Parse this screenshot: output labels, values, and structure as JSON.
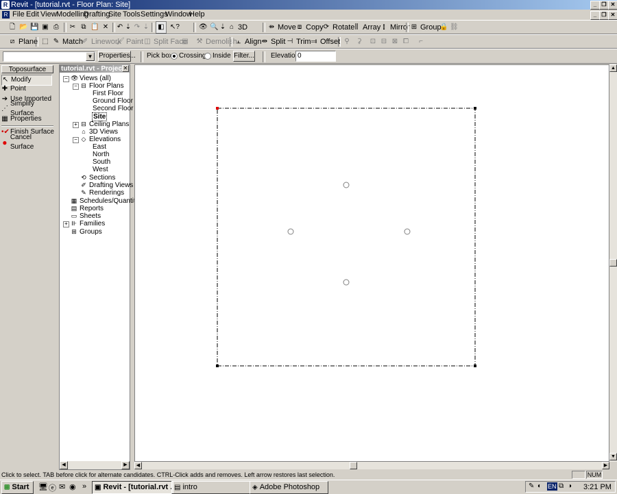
{
  "window": {
    "title": "Revit - [tutorial.rvt - Floor Plan: Site]",
    "controls": [
      "_",
      "❐",
      "✕"
    ],
    "doc_controls": [
      "_",
      "❐",
      "✕"
    ]
  },
  "menubar": [
    "File",
    "Edit",
    "View",
    "Modelling",
    "Drafting",
    "Site",
    "Tools",
    "Settings",
    "Window",
    "Help"
  ],
  "toolbar1": {
    "view_3d": "3D",
    "move": "Move",
    "copy": "Copy",
    "rotate": "Rotate",
    "array": "Array",
    "mirror": "Mirror",
    "group": "Group"
  },
  "toolbar2": {
    "plane": "Plane",
    "match": "Match",
    "linework": "Linework",
    "paint": "Paint",
    "split_face": "Split Face",
    "demolish": "Demolish",
    "align": "Align",
    "split": "Split",
    "trim": "Trim",
    "offset": "Offset"
  },
  "optionbar": {
    "type_value": "",
    "properties_button": "Properties...",
    "pick_box_label": "Pick box:",
    "crossing_label": "Crossing",
    "inside_label": "Inside",
    "selected_pick": "Crossing",
    "filter_button": "Filter...",
    "elevation_label": "Elevation",
    "elevation_value": "0"
  },
  "design_bar": {
    "tab": "Toposurface",
    "items": [
      "Modify",
      "Point",
      "Use Imported",
      "Simplify Surface",
      "Properties",
      "Finish Surface",
      "Cancel Surface"
    ],
    "active": "Modify"
  },
  "project_browser": {
    "title": "tutorial.rvt - Project",
    "close": "✕",
    "nodes": [
      "Views (all)",
      "Floor Plans",
      "First Floor",
      "Ground Floor",
      "Second Floor",
      "Site",
      "Ceiling Plans",
      "3D Views",
      "Elevations",
      "East",
      "North",
      "South",
      "West",
      "Sections",
      "Drafting Views",
      "Renderings",
      "Schedules/Quantities",
      "Reports",
      "Sheets",
      "Families",
      "Groups"
    ],
    "selected": "Site"
  },
  "statusbar": {
    "message": "Click to select. TAB before click for alternate candidates. CTRL-Click adds and removes. Left arrow restores last selection.",
    "num": "NUM"
  },
  "taskbar": {
    "start": "Start",
    "tasks": [
      "Revit - [tutorial.rvt ...",
      "intro",
      "Adobe Photoshop"
    ],
    "active_task": "Revit - [tutorial.rvt ...",
    "language": "EN",
    "clock": "3:21 PM"
  },
  "colors": {
    "title_gradient_start": "#0a246a",
    "title_gradient_end": "#a6caf0",
    "finish_icon": "#d00000",
    "cancel_icon": "#e00000",
    "selected_corner": "#e00000"
  }
}
